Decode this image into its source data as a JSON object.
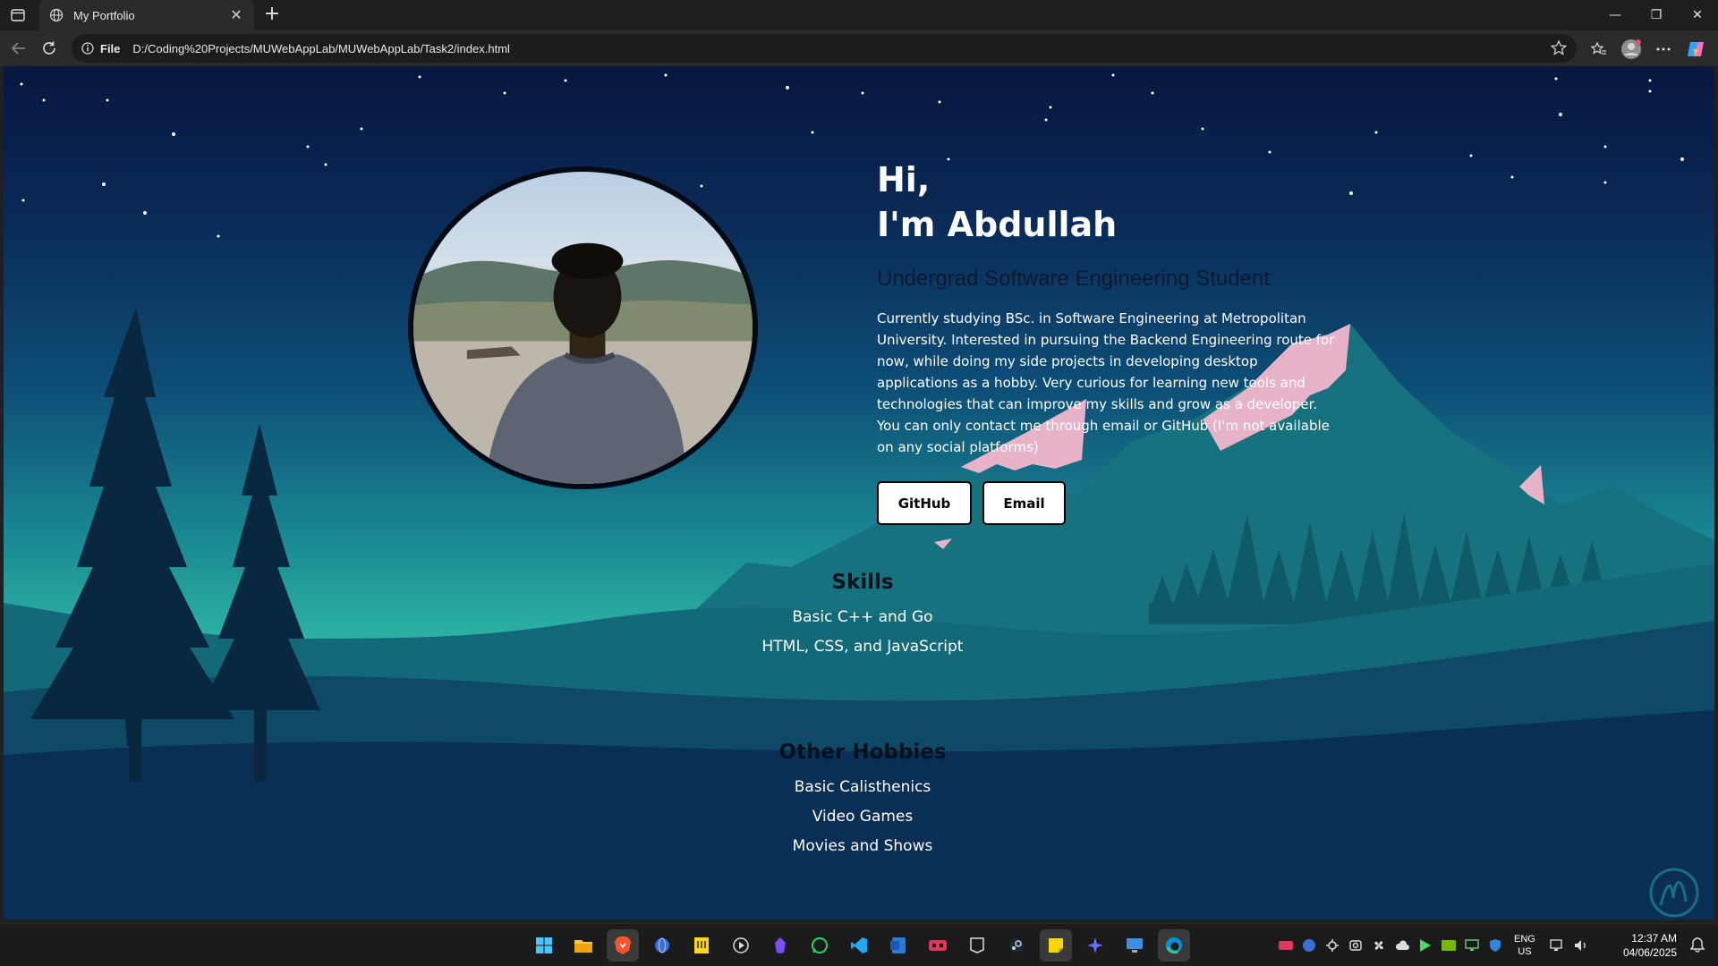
{
  "browser": {
    "tab_title": "My Portfolio",
    "address_protocol": "File",
    "address_url": "D:/Coding%20Projects/MUWebAppLab/MUWebAppLab/Task2/index.html"
  },
  "hero": {
    "greeting_line1": "Hi,",
    "greeting_line2": "I'm Abdullah",
    "role": "Undergrad Software Engineering Student",
    "bio": "Currently studying BSc. in Software Engineering at Metropolitan University. Interested in pursuing the Backend Engineering route for now, while doing my side projects in developing desktop applications as a hobby. Very curious for learning new tools and technologies that can improve my skills and grow as a developer. You can only contact me through email or GitHub (I'm not available on any social platforms)",
    "github_label": "GitHub",
    "email_label": "Email"
  },
  "skills": {
    "heading": "Skills",
    "items": [
      "Basic C++ and Go",
      "HTML, CSS, and JavaScript"
    ]
  },
  "hobbies": {
    "heading": "Other Hobbies",
    "items": [
      "Basic Calisthenics",
      "Video Games",
      "Movies and Shows"
    ]
  },
  "taskbar": {
    "lang_line1": "ENG",
    "lang_line2": "US",
    "time": "12:37 AM",
    "date": "04/06/2025"
  },
  "colors": {
    "accent_pink": "#e7b3c8",
    "mountain_teal": "#146f7a",
    "tree_dark": "#0a2740"
  }
}
